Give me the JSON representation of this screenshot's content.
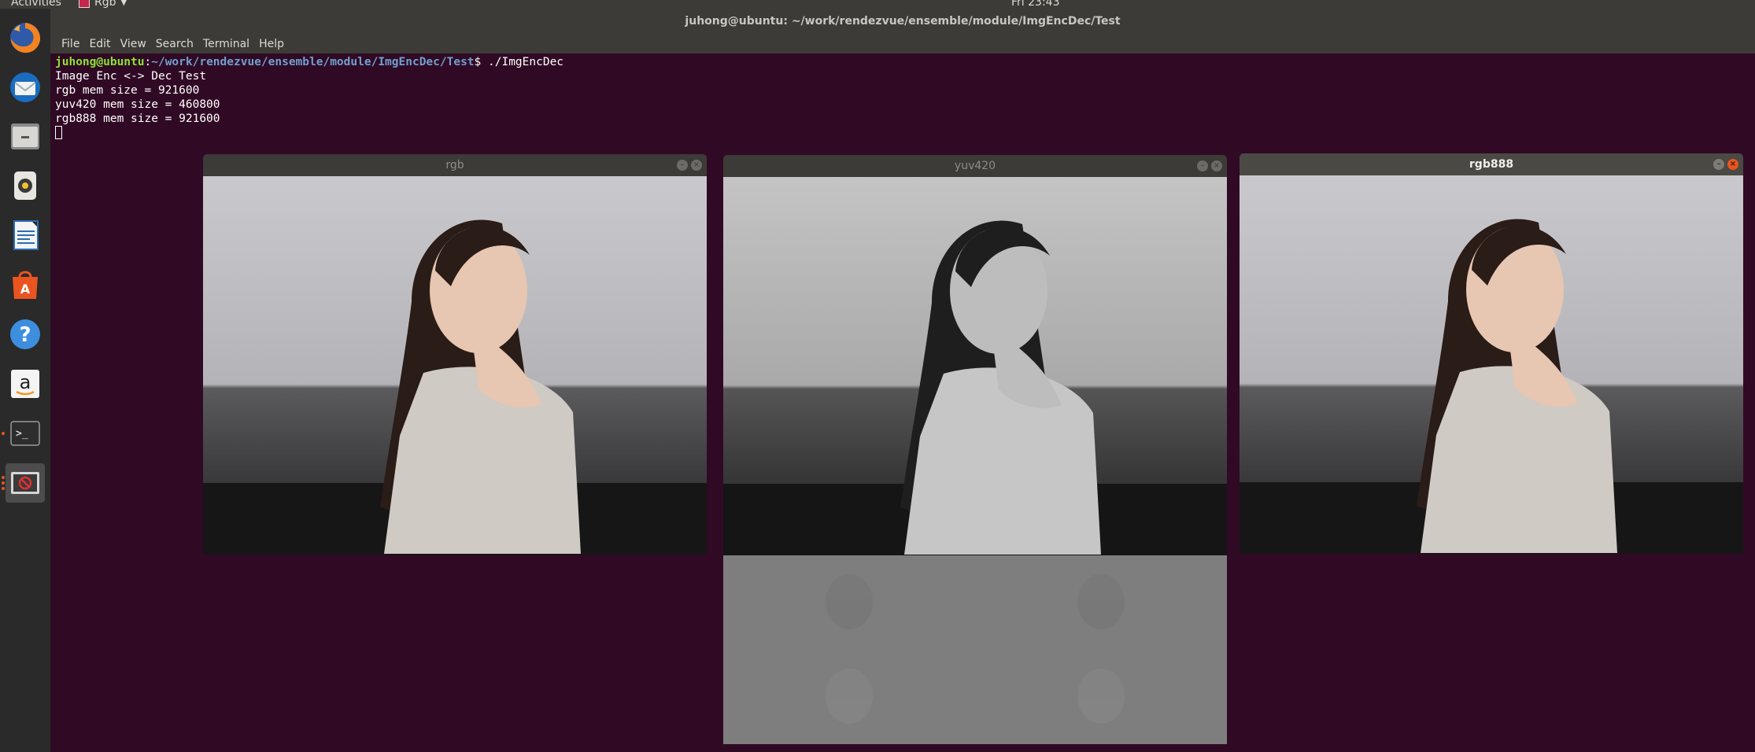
{
  "topbar": {
    "activities": "Activities",
    "app_menu": "Rgb",
    "clock": "Fri 23:43"
  },
  "terminal": {
    "window_title": "juhong@ubuntu: ~/work/rendezvue/ensemble/module/ImgEncDec/Test",
    "menu": [
      "File",
      "Edit",
      "View",
      "Search",
      "Terminal",
      "Help"
    ],
    "prompt_user": "juhong@ubuntu",
    "prompt_sep": ":",
    "prompt_path": "~/work/rendezvue/ensemble/module/ImgEncDec/Test",
    "prompt_cmd": "$ ./ImgEncDec",
    "output": [
      "Image Enc <-> Dec Test",
      "rgb mem size = 921600",
      "yuv420 mem size = 460800",
      "rgb888 mem size = 921600"
    ]
  },
  "dock": {
    "items": [
      {
        "icon": "firefox-icon"
      },
      {
        "icon": "thunderbird-icon"
      },
      {
        "icon": "files-icon"
      },
      {
        "icon": "rhythmbox-icon"
      },
      {
        "icon": "libreoffice-writer-icon"
      },
      {
        "icon": "ubuntu-software-icon"
      },
      {
        "icon": "help-icon"
      },
      {
        "icon": "amazon-icon"
      },
      {
        "icon": "terminal-icon"
      },
      {
        "icon": "image-viewer-icon"
      }
    ]
  },
  "windows": {
    "rgb": {
      "title": "rgb"
    },
    "yuv420": {
      "title": "yuv420"
    },
    "rgb888": {
      "title": "rgb888"
    }
  },
  "colors": {
    "terminal_bg": "#300a24",
    "prompt_user": "#8ae234",
    "prompt_path": "#729fcf",
    "ubuntu_orange": "#e95420"
  }
}
